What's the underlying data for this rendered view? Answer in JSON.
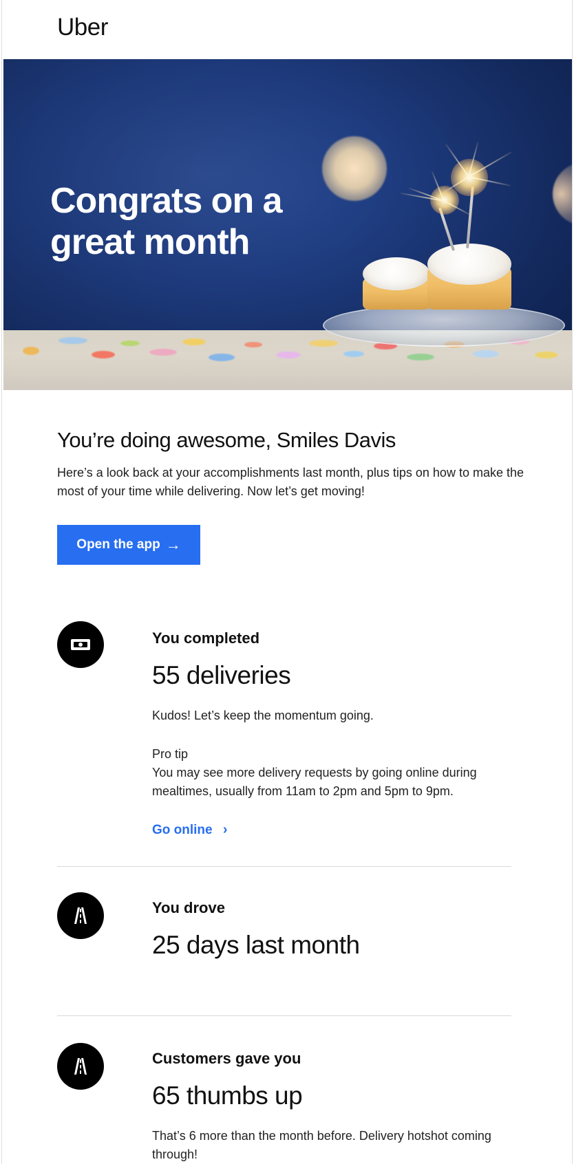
{
  "brand": {
    "name": "Uber"
  },
  "hero": {
    "title": "Congrats on a\ngreat month"
  },
  "main": {
    "greeting": "You’re doing awesome, Smiles Davis",
    "intro": "Here’s a look back at your accomplishments last month, plus tips on how to make the most of your time while delivering. Now let’s get moving!",
    "cta_label": "Open the app",
    "cta_arrow": "→",
    "cta_color": "#276ef1"
  },
  "stats": [
    {
      "kicker": "You completed",
      "metric": "55 deliveries",
      "message": "Kudos! Let’s keep the momentum going.",
      "pro_tip_label": "Pro tip",
      "pro_tip_text": "You may see more delivery requests by going online during mealtimes, usually from 11am to 2pm and 5pm to 9pm.",
      "link_label": "Go online",
      "link_chevron": "›",
      "icon": "money-icon"
    },
    {
      "kicker": "You drove",
      "metric": "25 days last month",
      "icon": "road-icon"
    },
    {
      "kicker": "Customers gave you",
      "metric": "65 thumbs up",
      "message": "That’s 6 more than the month before. Delivery hotshot coming through!",
      "icon": "road-icon"
    }
  ],
  "colors": {
    "hero_blue": "#1f3f87",
    "link_blue": "#276ef1",
    "text_dark": "#111111",
    "divider": "#d9d9d9"
  }
}
